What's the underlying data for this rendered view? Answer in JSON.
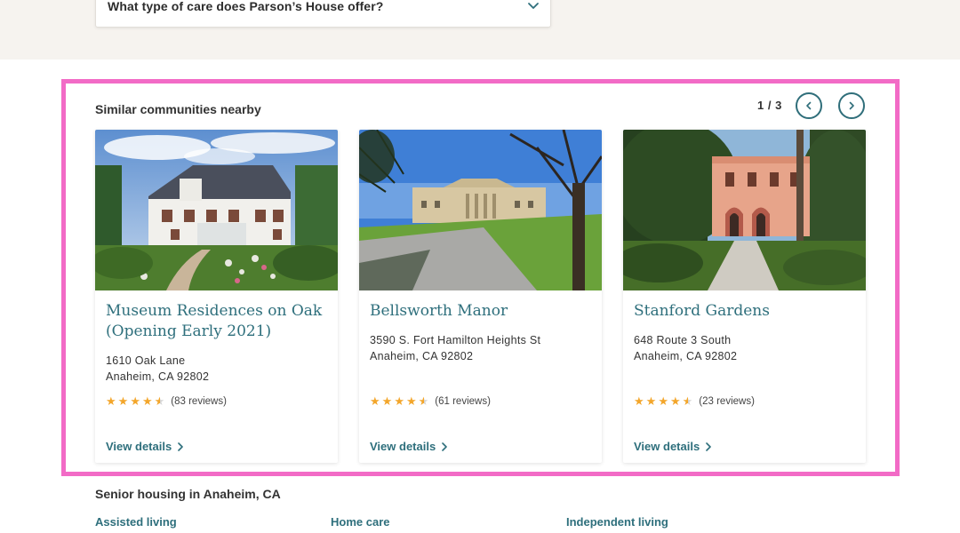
{
  "faq": {
    "question": "What type of care does Parson’s House offer?"
  },
  "similar": {
    "title": "Similar communities nearby",
    "pager": "1 / 3",
    "cards": [
      {
        "name": "Museum Residences on Oak (Opening Early 2021)",
        "address_line1": "1610 Oak Lane",
        "address_line2": "Anaheim, CA 92802",
        "rating": 4.5,
        "reviews": "(83 reviews)",
        "cta": "View details"
      },
      {
        "name": "Bellsworth Manor",
        "address_line1": "3590 S. Fort Hamilton Heights St",
        "address_line2": "Anaheim, CA 92802",
        "rating": 4.5,
        "reviews": "(61 reviews)",
        "cta": "View details"
      },
      {
        "name": "Stanford Gardens",
        "address_line1": "648 Route 3 South",
        "address_line2": "Anaheim, CA 92802",
        "rating": 4.5,
        "reviews": "(23 reviews)",
        "cta": "View details"
      }
    ]
  },
  "housing": {
    "title": "Senior housing in Anaheim, CA",
    "links": [
      "Assisted living",
      "Home care",
      "Independent living"
    ]
  },
  "colors": {
    "accent": "#2e6f7c",
    "highlight": "#f26bc6",
    "star": "#f3a62b",
    "band": "#f6f3ef"
  }
}
